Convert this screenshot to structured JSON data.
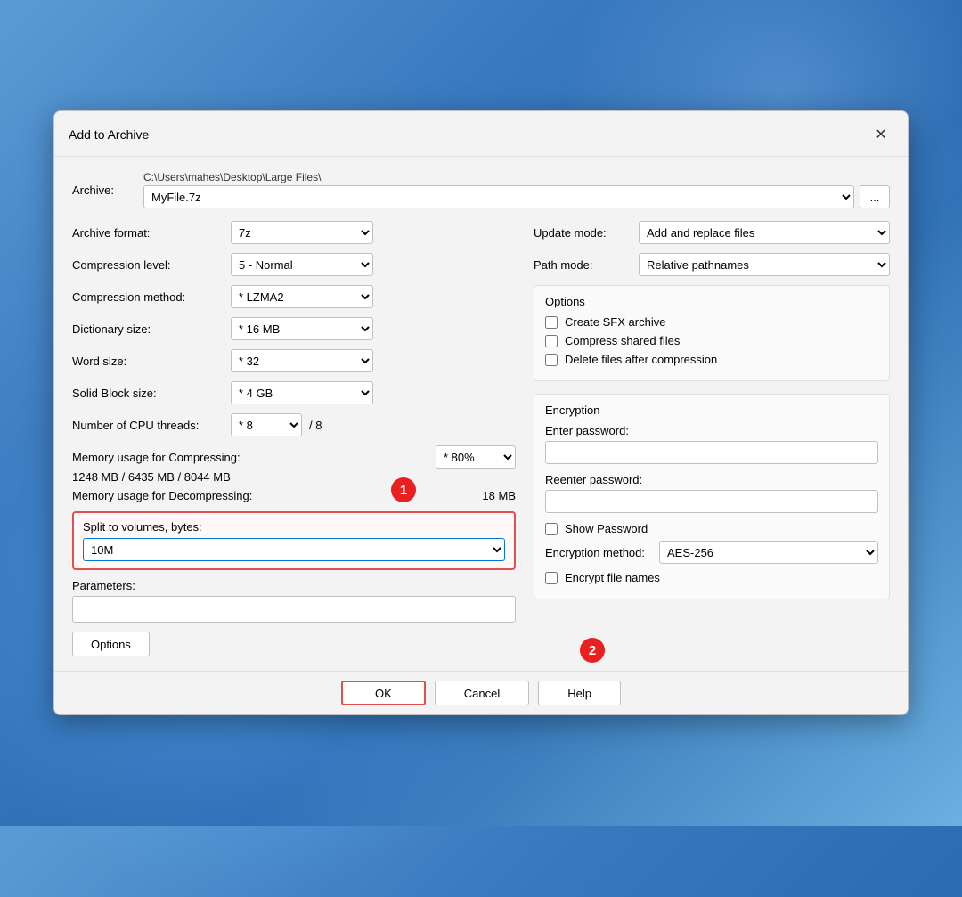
{
  "dialog": {
    "title": "Add to Archive",
    "close_label": "✕"
  },
  "archive": {
    "label": "Archive:",
    "path": "C:\\Users\\mahes\\Desktop\\Large Files\\",
    "filename": "MyFile.7z",
    "browse_label": "..."
  },
  "left": {
    "archive_format_label": "Archive format:",
    "archive_format_value": "7z",
    "compression_level_label": "Compression level:",
    "compression_level_value": "5 - Normal",
    "compression_method_label": "Compression method:",
    "compression_method_value": "* LZMA2",
    "dictionary_size_label": "Dictionary size:",
    "dictionary_size_value": "* 16 MB",
    "word_size_label": "Word size:",
    "word_size_value": "* 32",
    "solid_block_label": "Solid Block size:",
    "solid_block_value": "* 4 GB",
    "cpu_threads_label": "Number of CPU threads:",
    "cpu_threads_value": "* 8",
    "cpu_threads_max": "/ 8",
    "mem_compressing_label": "Memory usage for Compressing:",
    "mem_compressing_values": "1248 MB / 6435 MB / 8044 MB",
    "mem_compressing_select": "* 80%",
    "mem_decompressing_label": "Memory usage for Decompressing:",
    "mem_decompressing_value": "18 MB",
    "split_label": "Split to volumes, bytes:",
    "split_value": "10M",
    "params_label": "Parameters:",
    "params_value": "",
    "options_btn": "Options"
  },
  "right": {
    "update_mode_label": "Update mode:",
    "update_mode_value": "Add and replace files",
    "path_mode_label": "Path mode:",
    "path_mode_value": "Relative pathnames",
    "options_title": "Options",
    "create_sfx_label": "Create SFX archive",
    "create_sfx_checked": false,
    "compress_shared_label": "Compress shared files",
    "compress_shared_checked": false,
    "delete_after_label": "Delete files after compression",
    "delete_after_checked": false,
    "encryption_title": "Encryption",
    "enter_password_label": "Enter password:",
    "enter_password_value": "",
    "reenter_password_label": "Reenter password:",
    "reenter_password_value": "",
    "show_password_label": "Show Password",
    "show_password_checked": false,
    "enc_method_label": "Encryption method:",
    "enc_method_value": "AES-256",
    "encrypt_names_label": "Encrypt file names",
    "encrypt_names_checked": false
  },
  "footer": {
    "ok_label": "OK",
    "cancel_label": "Cancel",
    "help_label": "Help"
  },
  "badges": {
    "badge1": "1",
    "badge2": "2"
  }
}
